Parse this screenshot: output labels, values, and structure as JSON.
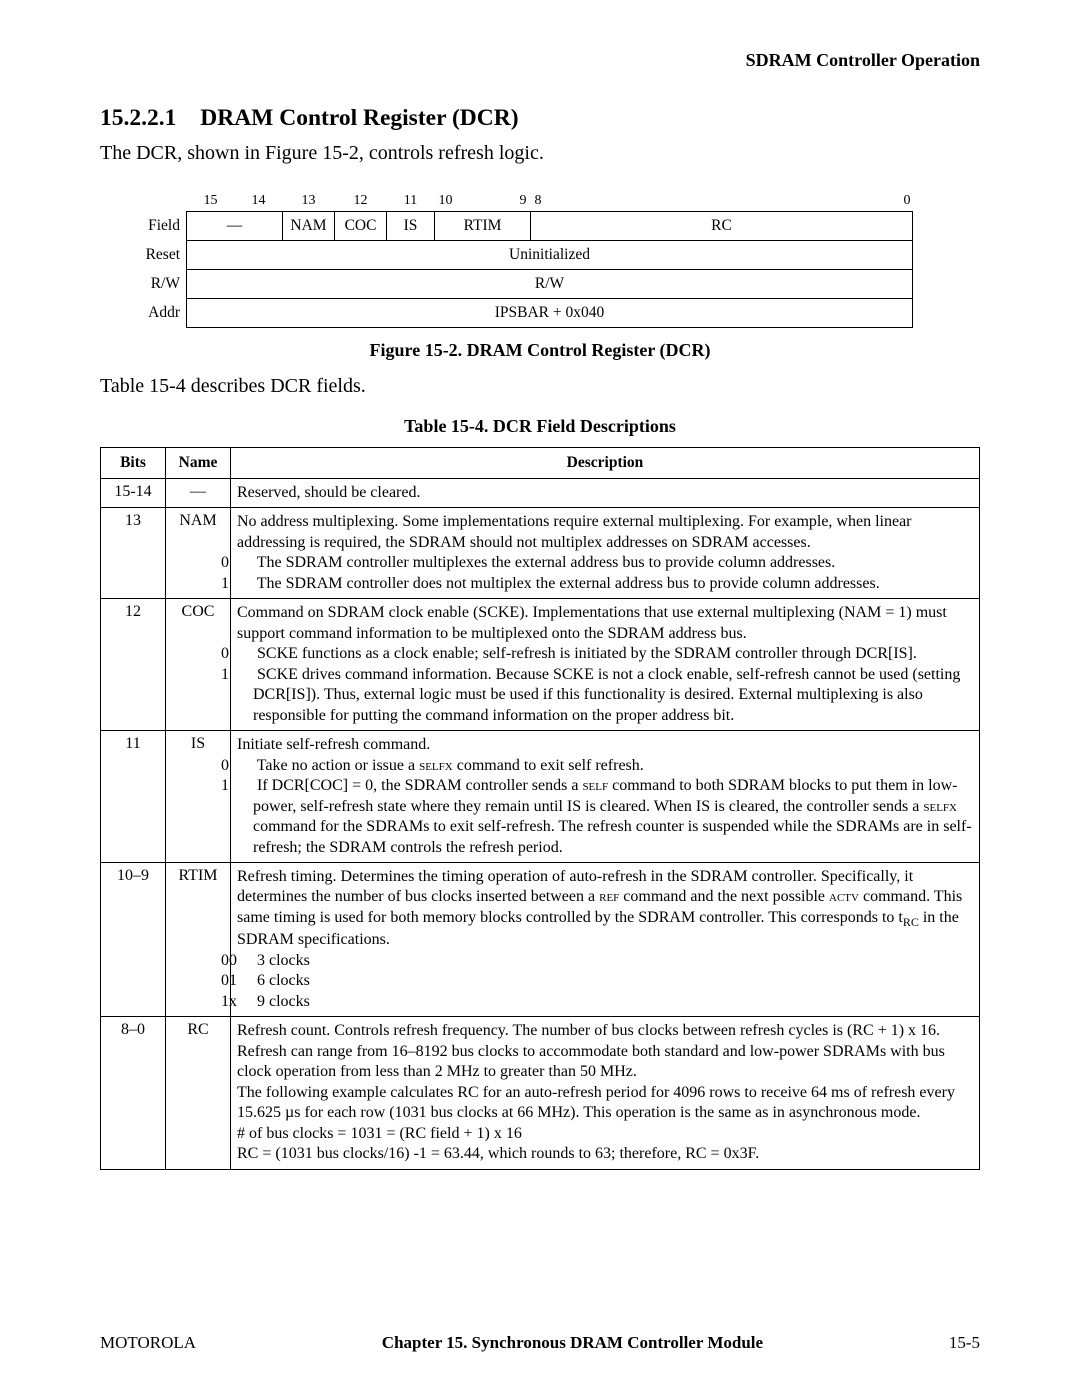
{
  "header": {
    "right": "SDRAM Controller Operation"
  },
  "section": {
    "number": "15.2.2.1",
    "title": "DRAM Control Register (DCR)"
  },
  "intro_para": "The DCR, shown in Figure 15-2, controls refresh logic.",
  "register": {
    "rowlabels": {
      "field": "Field",
      "reset": "Reset",
      "rw": "R/W",
      "addr": "Addr"
    },
    "bitnums": [
      "15",
      "14",
      "13",
      "12",
      "11",
      "10",
      "9",
      "8",
      "0"
    ],
    "fields": {
      "dash": "—",
      "nam": "NAM",
      "coc": "COC",
      "is": "IS",
      "rtim": "RTIM",
      "rc": "RC"
    },
    "reset": "Uninitialized",
    "rw": "R/W",
    "addr": "IPSBAR + 0x040"
  },
  "figure_caption": "Figure 15-2. DRAM Control Register (DCR)",
  "mid_para": "Table 15-4 describes DCR fields.",
  "table_caption": "Table 15-4. DCR Field Descriptions",
  "table_headers": {
    "bits": "Bits",
    "name": "Name",
    "desc": "Description"
  },
  "rows": [
    {
      "bits": "15-14",
      "name": "—",
      "lead": "Reserved, should be cleared.",
      "options": []
    },
    {
      "bits": "13",
      "name": "NAM",
      "lead": "No address multiplexing. Some implementations require external multiplexing. For example, when linear addressing is required, the SDRAM should not multiplex addresses on SDRAM accesses.",
      "options": [
        {
          "key": "0",
          "text": "The SDRAM controller multiplexes the external address bus to provide column addresses."
        },
        {
          "key": "1",
          "text": "The SDRAM controller does not multiplex the external address bus to provide column addresses."
        }
      ]
    },
    {
      "bits": "12",
      "name": "COC",
      "lead": "Command on SDRAM clock enable (SCKE). Implementations that use external multiplexing (NAM = 1) must support command information to be multiplexed onto the SDRAM address bus.",
      "options": [
        {
          "key": "0",
          "text": "SCKE functions as a clock enable; self-refresh is initiated by the SDRAM controller through DCR[IS]."
        },
        {
          "key": "1",
          "text": "SCKE drives command information. Because SCKE is not a clock enable, self-refresh cannot be used (setting DCR[IS]). Thus, external logic must be used if this functionality is desired. External multiplexing is also responsible for putting the command information on the proper address bit."
        }
      ]
    },
    {
      "bits": "11",
      "name": "IS",
      "lead": "Initiate self-refresh command.",
      "options": [
        {
          "key": "0",
          "text_pre": "Take no action or issue a ",
          "sc": "selfx",
          "text_post": " command to exit self refresh."
        },
        {
          "key": "1",
          "text_pre": "If DCR[COC] = 0, the SDRAM controller sends a ",
          "sc": "self",
          "text_post": " command to both SDRAM blocks to put them in low-power, self-refresh state where they remain until IS is cleared. When IS is cleared, the controller sends a ",
          "sc2": "selfx",
          "text_post2": " command for the SDRAMs to exit self-refresh. The refresh counter is suspended while the SDRAMs are in self-refresh; the SDRAM controls the refresh period."
        }
      ]
    },
    {
      "bits": "10–9",
      "name": "RTIM",
      "lead_pre": "Refresh timing. Determines the timing operation of auto-refresh in the SDRAM controller. Specifically, it determines the number of bus clocks inserted between a ",
      "lead_sc": "ref",
      "lead_mid": " command and the next possible ",
      "lead_sc2": "actv",
      "lead_post": " command. This same timing is used for both memory blocks controlled by the SDRAM controller. This corresponds to t",
      "lead_sub": "RC",
      "lead_tail": " in the SDRAM specifications.",
      "options": [
        {
          "key": "00",
          "text": "3 clocks"
        },
        {
          "key": "01",
          "text": "6 clocks"
        },
        {
          "key": "1x",
          "text": "9 clocks"
        }
      ]
    },
    {
      "bits": "8–0",
      "name": "RC",
      "lines": [
        "Refresh count. Controls refresh frequency. The number of bus clocks between refresh cycles is (RC + 1) x 16. Refresh can range from 16–8192 bus clocks to accommodate both standard and low-power SDRAMs with bus clock operation from less than 2 MHz to greater than 50 MHz.",
        "The following example calculates RC for an auto-refresh period for 4096 rows to receive 64 ms of refresh every 15.625 µs for each row (1031 bus clocks at 66 MHz). This operation is the same as in asynchronous mode.",
        "# of bus clocks = 1031 = (RC field + 1) x 16",
        "RC = (1031 bus clocks/16) -1 = 63.44, which rounds to 63; therefore, RC = 0x3F."
      ]
    }
  ],
  "footer": {
    "left": "MOTOROLA",
    "center": "Chapter 15.  Synchronous DRAM Controller Module",
    "right": "15-5"
  }
}
